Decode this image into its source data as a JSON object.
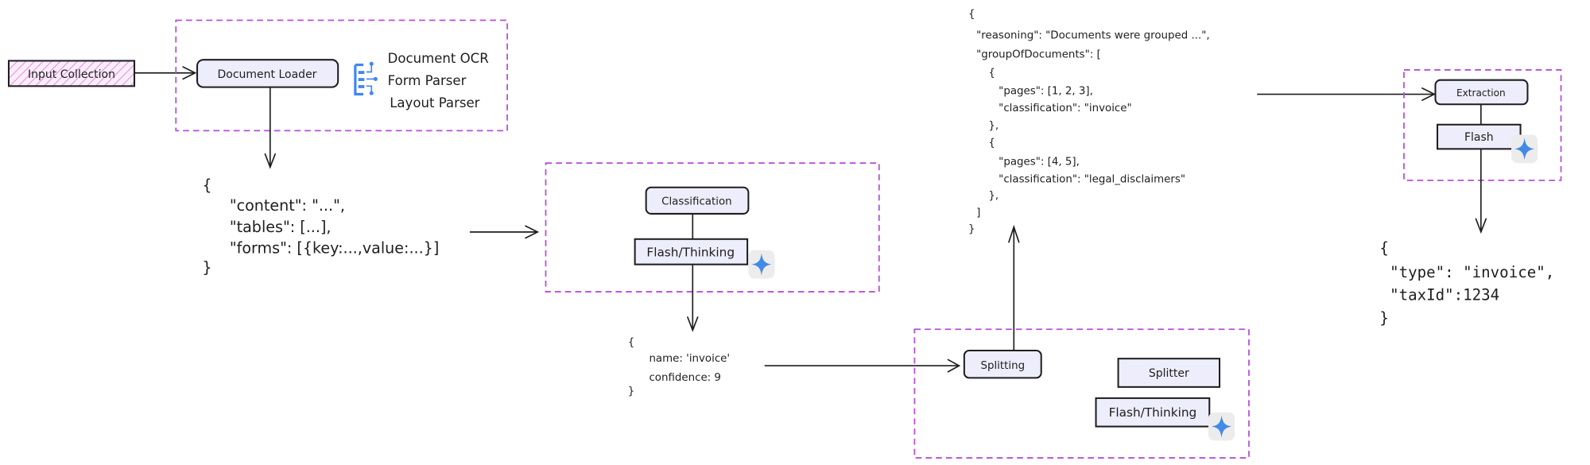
{
  "diagram": {
    "input": {
      "label": "Input Collection"
    },
    "loader": {
      "label": "Document Loader",
      "processors": [
        "Document OCR",
        "Form Parser",
        "Layout Parser"
      ],
      "icon": "document-ai-icon"
    },
    "loader_output": [
      "{",
      "\"content\": \"...\",",
      "\"tables\": [...],",
      "\"forms\": [{key:...,value:...}]",
      "}"
    ],
    "classification": {
      "label": "Classification",
      "model": "Flash/Thinking",
      "icon": "gemini-sparkle-icon"
    },
    "classification_output": [
      "{",
      "name: 'invoice'",
      "confidence: 9",
      "}"
    ],
    "splitting": {
      "label": "Splitting",
      "tool": "Splitter",
      "model": "Flash/Thinking",
      "icon": "gemini-sparkle-icon"
    },
    "splitting_output": [
      "{",
      "\"reasoning\": \"Documents were grouped ...\",",
      "\"groupOfDocuments\": [",
      "{",
      "\"pages\": [1, 2, 3],",
      "\"classification\": \"invoice\"",
      "},",
      "{",
      "\"pages\": [4, 5],",
      "\"classification\": \"legal_disclaimers\"",
      "},",
      "]",
      "}"
    ],
    "extraction": {
      "label": "Extraction",
      "model": "Flash",
      "icon": "gemini-sparkle-icon"
    },
    "extraction_output": [
      "{",
      "\"type\": \"invoice\",",
      "\"taxId\":1234",
      "}"
    ],
    "colors": {
      "group_border": "#b64fd8",
      "node_fill": "#eeedfc",
      "input_hatch": "#e58be5",
      "gemini": "#4a7de8"
    }
  }
}
